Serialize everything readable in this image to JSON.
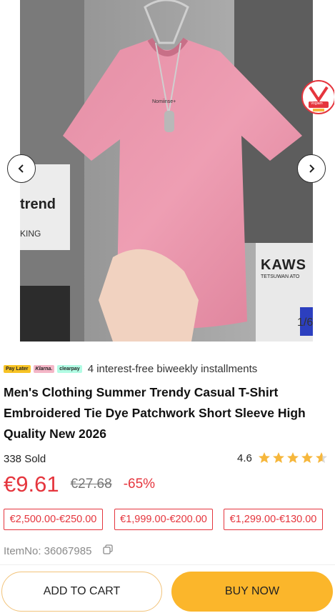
{
  "gallery": {
    "counter": "1/6",
    "shirt_print": "Nomiinse+",
    "bg_text_left": "trend",
    "bg_text_left2": "KING",
    "bg_text_right": "KAWS",
    "bg_text_right2": "TETSUWAN ATO",
    "badge_text": "Vogiam"
  },
  "payment": {
    "logos": [
      "Pay Later",
      "Klarna.",
      "clearpay"
    ],
    "text": "4 interest-free biweekly installments"
  },
  "product": {
    "title": "Men's Clothing Summer Trendy Casual T-Shirt Embroidered Tie Dye Patchwork Short Sleeve High Quality New 2026",
    "sold": "338 Sold",
    "rating": "4.6",
    "rating_value": 4.6,
    "price": "€9.61",
    "old_price": "€27.68",
    "discount": "-65%",
    "coupons": [
      "€2,500.00-€250.00",
      "€1,999.00-€200.00",
      "€1,299.00-€130.00"
    ],
    "item_no": "ItemNo: 36067985"
  },
  "actions": {
    "add_to_cart": "ADD TO CART",
    "buy_now": "BUY NOW"
  },
  "colors": {
    "price": "#e5353d",
    "buy": "#fbb62b",
    "star": "#f6b73c"
  }
}
